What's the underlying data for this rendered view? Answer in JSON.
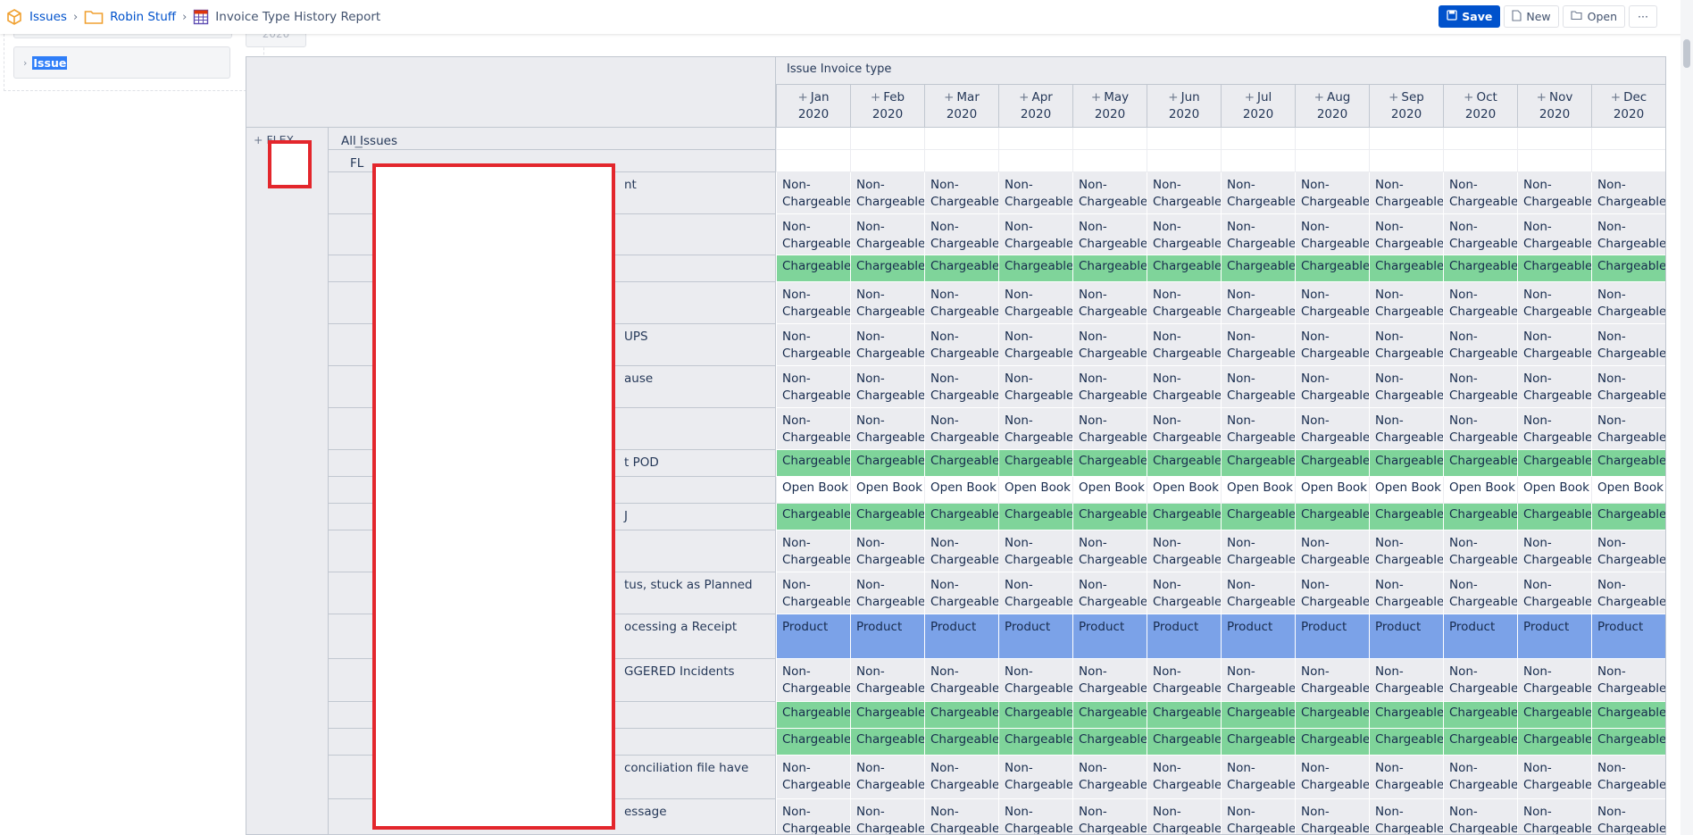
{
  "breadcrumb": {
    "root": "Issues",
    "folder": "Robin Stuff",
    "report": "Invoice Type History Report"
  },
  "toolbar": {
    "save": "Save",
    "new": "New",
    "open": "Open",
    "more": "···"
  },
  "left_panel": {
    "issue_label": "Issue",
    "year_stub": "2020"
  },
  "report": {
    "column_dimension": "Issue Invoice type",
    "months": [
      {
        "name": "Jan",
        "year": "2020"
      },
      {
        "name": "Feb",
        "year": "2020"
      },
      {
        "name": "Mar",
        "year": "2020"
      },
      {
        "name": "Apr",
        "year": "2020"
      },
      {
        "name": "May",
        "year": "2020"
      },
      {
        "name": "Jun",
        "year": "2020"
      },
      {
        "name": "Jul",
        "year": "2020"
      },
      {
        "name": "Aug",
        "year": "2020"
      },
      {
        "name": "Sep",
        "year": "2020"
      },
      {
        "name": "Oct",
        "year": "2020"
      },
      {
        "name": "Nov",
        "year": "2020"
      },
      {
        "name": "Dec",
        "year": "2020"
      }
    ],
    "row_dimension_label": "FLEX",
    "all_issues": "All Issues",
    "group_label": "FL",
    "value_labels": {
      "nc_line1": "Non-",
      "nc_line2": "Chargeable",
      "c": "Chargeable",
      "ob": "Open Book",
      "p": "Product"
    },
    "rows": [
      {
        "label": "",
        "type": "empty",
        "height": 25
      },
      {
        "label": "",
        "type": "empty",
        "height": 25
      },
      {
        "label": "nt",
        "type": "nc",
        "height": 47
      },
      {
        "label": "",
        "type": "nc",
        "height": 46
      },
      {
        "label": "",
        "type": "c",
        "height": 30
      },
      {
        "label": "",
        "type": "nc",
        "height": 47
      },
      {
        "label": "UPS",
        "type": "nc",
        "height": 47
      },
      {
        "label": "ause",
        "type": "nc",
        "height": 47
      },
      {
        "label": "",
        "type": "nc",
        "height": 47
      },
      {
        "label": "t POD",
        "type": "c",
        "height": 30
      },
      {
        "label": "",
        "type": "ob",
        "height": 30
      },
      {
        "label": "J",
        "type": "c",
        "height": 30
      },
      {
        "label": "",
        "type": "nc",
        "height": 47
      },
      {
        "label": "tus, stuck as Planned",
        "type": "nc",
        "height": 47
      },
      {
        "label": "ocessing a Receipt",
        "type": "p",
        "height": 50
      },
      {
        "label": "GGERED Incidents",
        "type": "nc",
        "height": 48
      },
      {
        "label": "",
        "type": "c",
        "height": 30
      },
      {
        "label": "",
        "type": "c",
        "height": 30
      },
      {
        "label": "conciliation file have",
        "type": "nc",
        "height": 49
      },
      {
        "label": "essage",
        "type": "nc",
        "height": 48
      }
    ]
  }
}
